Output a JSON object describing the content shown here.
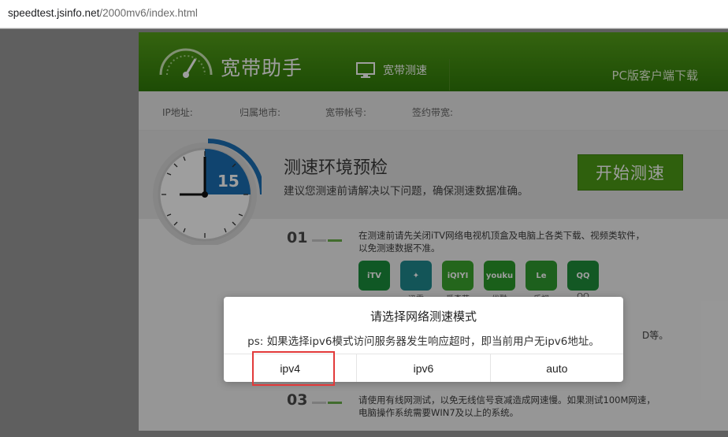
{
  "browser": {
    "url_host": "speedtest.jsinfo.net",
    "url_path": "/2000mv6/index.html"
  },
  "header": {
    "brand": "宽带助手",
    "nav_speed": "宽带测速",
    "pc_download": "PC版客户端下载",
    "gauge_icon": "speedometer-icon",
    "monitor_icon": "monitor-icon"
  },
  "info": {
    "ip": "IP地址:",
    "region": "归属地市:",
    "account": "宽带帐号:",
    "bandwidth": "签约带宽:"
  },
  "precheck": {
    "timer": "15",
    "title": "测速环境预检",
    "subtitle": "建议您测速前请解决以下问题，确保测速数据准确。",
    "start_button": "开始测速"
  },
  "steps": [
    {
      "num": "01",
      "text_line1": "在测速前请先关闭iTV网络电视机顶盒及电脑上各类下载、视频类软件，",
      "text_line2": "以免测速数据不准。"
    },
    {
      "num": "03",
      "text_line1": "请使用有线网测试，以免无线信号衰减造成网速慢。如果测试100M网速，",
      "text_line2": "电脑操作系统需要WIN7及以上的系统。"
    }
  ],
  "apps": [
    {
      "icon": "itv-app-icon",
      "text": "iTV",
      "bg": "#1a8f3c",
      "label": ""
    },
    {
      "icon": "thunder-app-icon",
      "text": "✦",
      "bg": "#1f8a8f",
      "label": "迅雷"
    },
    {
      "icon": "iqiyi-app-icon",
      "text": "iQIYI",
      "bg": "#3aa52e",
      "label": "爱奇艺"
    },
    {
      "icon": "youku-app-icon",
      "text": "youku",
      "bg": "#2a9a2a",
      "label": "优酷"
    },
    {
      "icon": "letv-app-icon",
      "text": "Le",
      "bg": "#2f9b2f",
      "label": "乐视"
    },
    {
      "icon": "qq-app-icon",
      "text": "QQ",
      "bg": "#1f8f3a",
      "label": "QQ"
    }
  ],
  "partial_text": "D等。",
  "modal": {
    "title": "请选择网络测速模式",
    "note": "ps: 如果选择ipv6模式访问服务器发生响应超时，即当前用户无ipv6地址。",
    "options": [
      "ipv4",
      "ipv6",
      "auto"
    ],
    "highlighted_option": "ipv4"
  },
  "colors": {
    "brand_green": "#4d9c16",
    "header_dark": "#2f7a08",
    "highlight_red": "#e23a3a",
    "clock_blue": "#1a6fb3"
  }
}
